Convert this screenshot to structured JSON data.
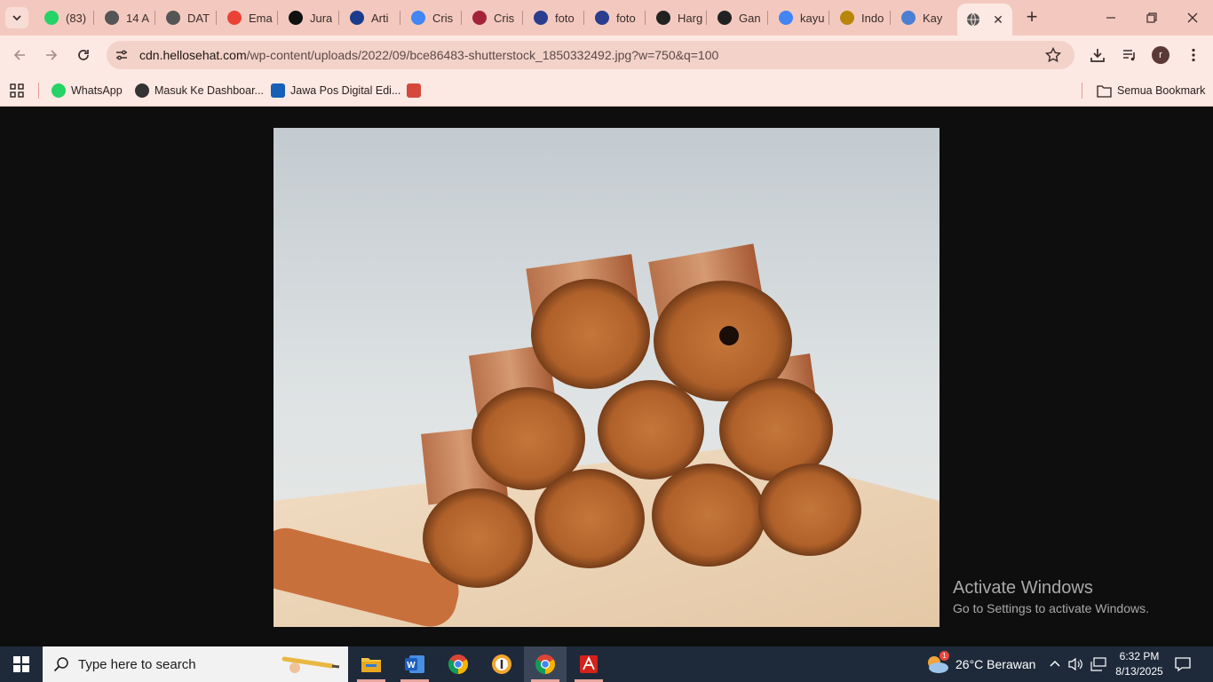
{
  "colors": {
    "tabstrip": "#f3c9bf",
    "toolbar": "#fde9e3",
    "viewer_bg": "#0e0e0e",
    "taskbar": "#1e2a3a"
  },
  "tabs": [
    {
      "title": "(83)",
      "icon": "whatsapp-icon",
      "color": "#25d366"
    },
    {
      "title": "14 A",
      "icon": "globe-icon",
      "color": "#555555"
    },
    {
      "title": "DAT",
      "icon": "globe-icon",
      "color": "#555555"
    },
    {
      "title": "Ema",
      "icon": "gmail-icon",
      "color": "#ea4335"
    },
    {
      "title": "Jura",
      "icon": "site-icon",
      "color": "#111111"
    },
    {
      "title": "Arti",
      "icon": "site-icon",
      "color": "#1a3c8c"
    },
    {
      "title": "Cris",
      "icon": "google-icon",
      "color": "#4285f4"
    },
    {
      "title": "Cris",
      "icon": "b-icon",
      "color": "#a3243a"
    },
    {
      "title": "foto",
      "icon": "d-icon",
      "color": "#2a3d8f"
    },
    {
      "title": "foto",
      "icon": "d-icon",
      "color": "#2a3d8f"
    },
    {
      "title": "Harg",
      "icon": "openai-icon",
      "color": "#222222"
    },
    {
      "title": "Gan",
      "icon": "r-icon",
      "color": "#222222"
    },
    {
      "title": "kayu",
      "icon": "google-icon",
      "color": "#4285f4"
    },
    {
      "title": "Indo",
      "icon": "garuda-icon",
      "color": "#b8860b"
    },
    {
      "title": "Kay",
      "icon": "site-icon",
      "color": "#4a7fd4"
    }
  ],
  "active_tab": {
    "title": "",
    "icon": "globe-icon"
  },
  "toolbar": {
    "url_host": "cdn.hellosehat.com",
    "url_path": "/wp-content/uploads/2022/09/bce86483-shutterstock_1850332492.jpg?w=750&q=100",
    "avatar_letter": "r"
  },
  "bookmarks": [
    {
      "label": "WhatsApp",
      "icon": "whatsapp-icon",
      "color": "#25d366"
    },
    {
      "label": "Masuk Ke Dashboar...",
      "icon": "globe-icon",
      "color": "#333333"
    },
    {
      "label": "Jawa Pos Digital Edi...",
      "icon": "jp-icon",
      "color": "#1760b8"
    },
    {
      "label": "",
      "icon": "jpn-icon",
      "color": "#d6483a"
    }
  ],
  "all_bookmarks_label": "Semua Bookmark",
  "watermark": {
    "line1": "Activate Windows",
    "line2": "Go to Settings to activate Windows."
  },
  "taskbar": {
    "search_placeholder": "Type here to search",
    "weather": "26°C Berawan",
    "weather_badge": "1",
    "time": "6:32 PM",
    "date": "8/13/2025"
  }
}
